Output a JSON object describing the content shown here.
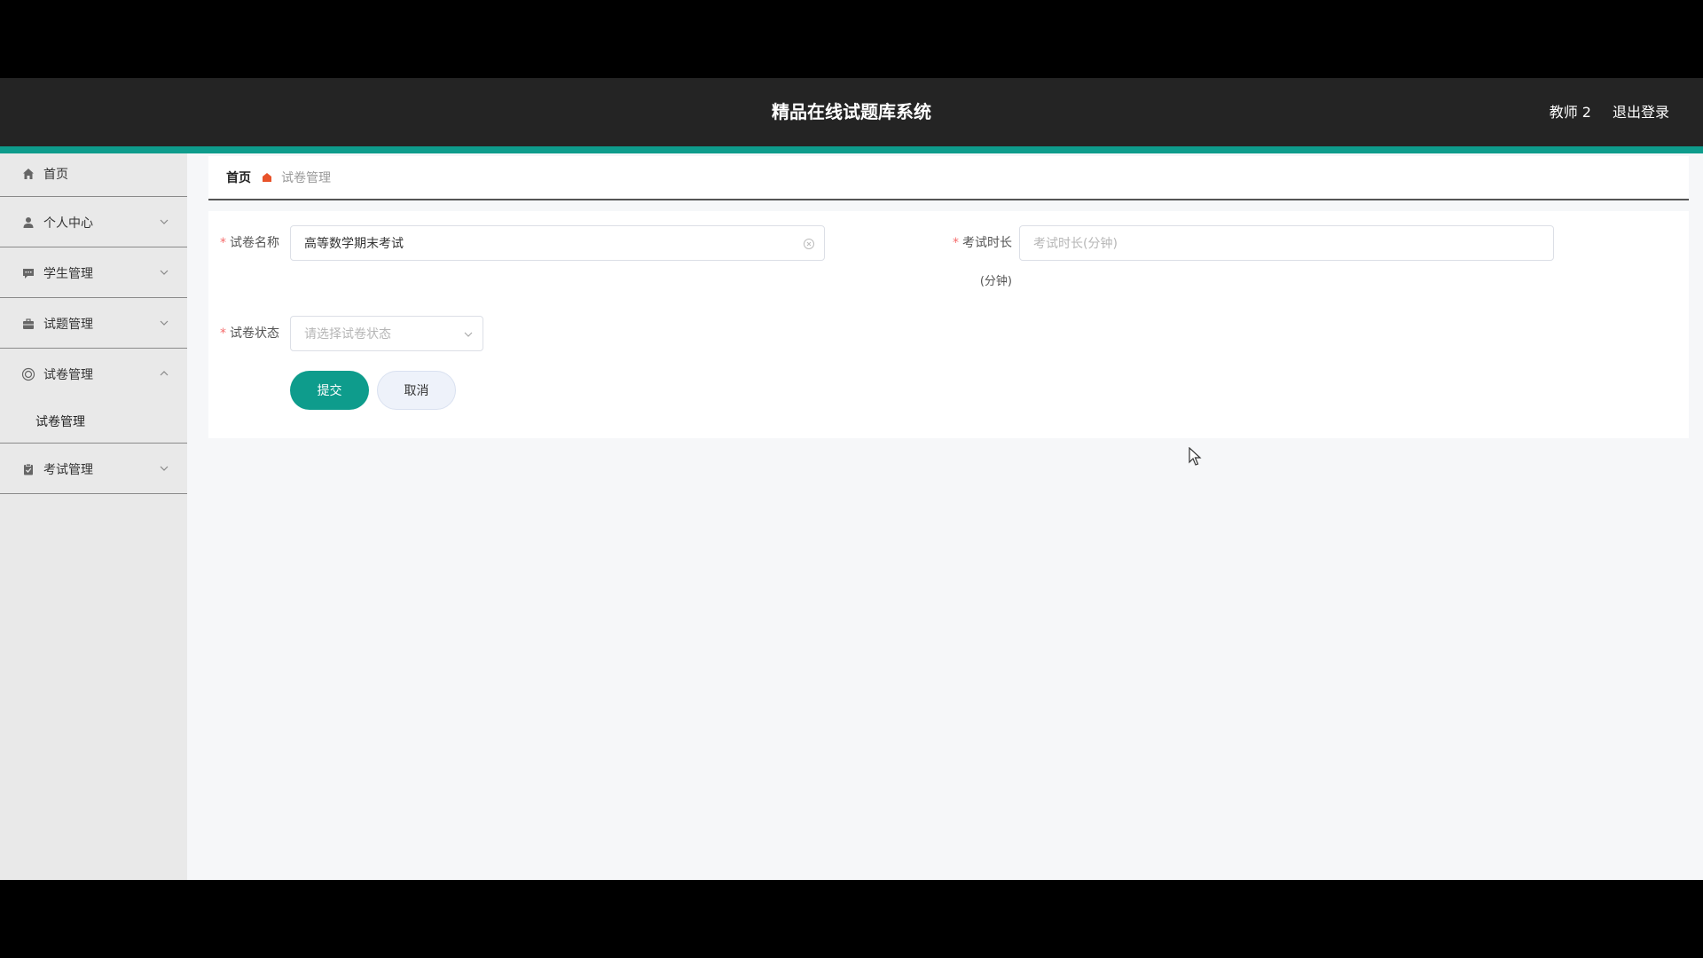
{
  "header": {
    "title": "精品在线试题库系统",
    "user": "教师 2",
    "logout": "退出登录"
  },
  "sidebar": {
    "items": [
      {
        "label": "首页",
        "icon": "home-icon"
      },
      {
        "label": "个人中心",
        "icon": "user-icon"
      },
      {
        "label": "学生管理",
        "icon": "chat-icon"
      },
      {
        "label": "试题管理",
        "icon": "briefcase-icon"
      },
      {
        "label": "试卷管理",
        "icon": "paper-icon",
        "sub": [
          "试卷管理"
        ]
      },
      {
        "label": "考试管理",
        "icon": "clipboard-icon"
      }
    ]
  },
  "breadcrumb": {
    "home": "首页",
    "current": "试卷管理"
  },
  "form": {
    "name_label": "试卷名称",
    "name_value": "高等数学期末考试",
    "duration_label": "考试时长",
    "duration_placeholder": "考试时长(分钟)",
    "duration_unit": "(分钟)",
    "status_label": "试卷状态",
    "status_placeholder": "请选择试卷状态",
    "submit": "提交",
    "cancel": "取消"
  },
  "colors": {
    "accent": "#0e9c8c",
    "header_bg": "#242424",
    "sidebar_bg": "#e9e9e9",
    "required": "#f56c6c",
    "breadcrumb_icon": "#e8532a"
  }
}
